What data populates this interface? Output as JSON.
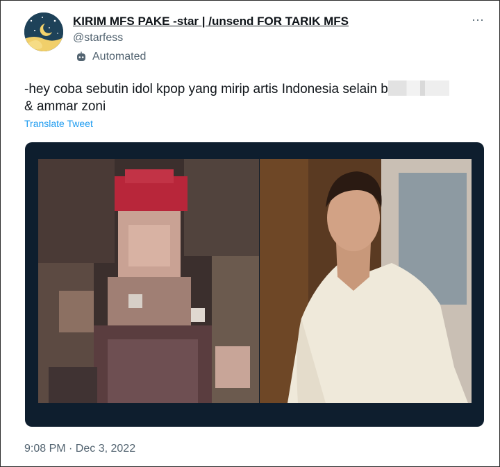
{
  "tweet": {
    "display_name": "KIRIM MFS PAKE -star | /unsend FOR TARIK MFS",
    "handle": "@starfess",
    "automated_label": "Automated",
    "text_before": "-hey coba sebutin idol kpop yang mirip artis Indonesia selain b",
    "text_after": "& ammar zoni",
    "translate_label": "Translate Tweet",
    "timestamp": "9:08 PM · Dec 3, 2022"
  },
  "icons": {
    "more": "more-horizontal-icon",
    "automated": "bot-icon",
    "avatar": "moon-stars-avatar"
  },
  "colors": {
    "link": "#1d9bf0",
    "secondary_text": "#536471",
    "media_background": "#0e1e2e"
  }
}
